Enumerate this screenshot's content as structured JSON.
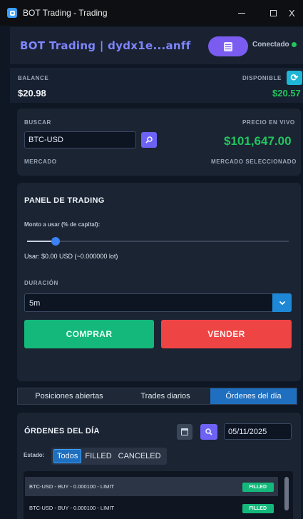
{
  "window": {
    "title": "BOT Trading - Trading",
    "minimize": "–",
    "maximize": "□",
    "close": "X"
  },
  "header": {
    "title": "BOT Trading  |  dydx1e...anff",
    "status": "Conectado"
  },
  "balance": {
    "label": "BALANCE",
    "value": "$20.98",
    "available_label": "DISPONIBLE",
    "available_value": "$20.57",
    "refresh_icon": "refresh-icon"
  },
  "search": {
    "label": "BUSCAR",
    "value": "BTC-USD",
    "price_label": "PRECIO EN VIVO",
    "price": "$101,647.00",
    "market_label": "MERCADO",
    "market_selected_label": "MERCADO SELECCIONADO"
  },
  "trading": {
    "title": "PANEL DE TRADING",
    "amount_label": "Monto a usar (% de capital):",
    "slider_percent": 11,
    "use_text": "Usar: $0.00 USD  (~0.000000 lot)",
    "duration_label": "DURACIÓN",
    "duration_value": "5m",
    "buy_label": "COMPRAR",
    "sell_label": "VENDER"
  },
  "tabs": [
    {
      "label": "Posiciones abiertas",
      "active": false
    },
    {
      "label": "Trades diarios",
      "active": false
    },
    {
      "label": "Órdenes del día",
      "active": true
    }
  ],
  "orders": {
    "title": "ÓRDENES DEL DÍA",
    "date": "05/11/2025",
    "status_label": "Estado:",
    "filters": [
      "Todos",
      "FILLED",
      "CANCELED"
    ],
    "active_filter": "Todos",
    "rows": [
      {
        "text": "BTC-USD - BUY - 0.000100 - LIMIT",
        "status": "FILLED"
      },
      {
        "text": "BTC-USD - BUY - 0.000100 - LIMIT",
        "status": "FILLED"
      }
    ]
  },
  "colors": {
    "accent": "#7b5cf0",
    "buy": "#14b87b",
    "sell": "#ef4444",
    "price": "#22c55e",
    "active_tab": "#1e6fbf"
  }
}
